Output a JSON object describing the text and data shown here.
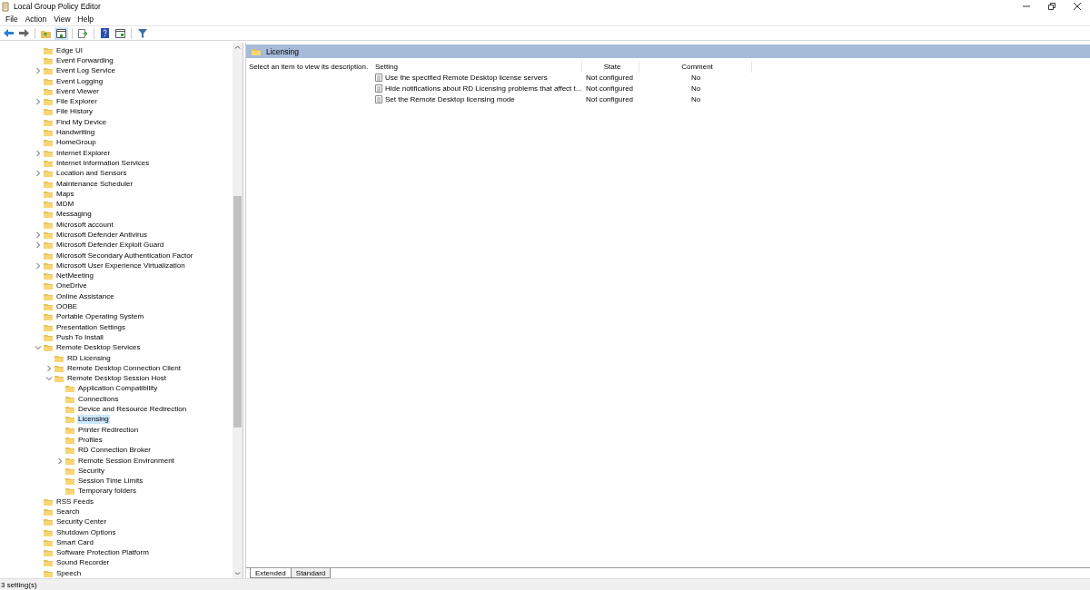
{
  "window": {
    "title": "Local Group Policy Editor"
  },
  "menu": [
    "File",
    "Action",
    "View",
    "Help"
  ],
  "tree": [
    {
      "label": "Edge UI",
      "selected": false
    },
    {
      "label": "Event Forwarding",
      "selected": false
    },
    {
      "label": "Event Log Service",
      "selected": false,
      "expanded": false
    },
    {
      "label": "Event Logging",
      "selected": false
    },
    {
      "label": "Event Viewer",
      "selected": false
    },
    {
      "label": "File Explorer",
      "selected": false,
      "expanded": false
    },
    {
      "label": "File History",
      "selected": false
    },
    {
      "label": "Find My Device",
      "selected": false
    },
    {
      "label": "Handwriting",
      "selected": false
    },
    {
      "label": "HomeGroup",
      "selected": false
    },
    {
      "label": "Internet Explorer",
      "selected": false,
      "expanded": false
    },
    {
      "label": "Internet Information Services",
      "selected": false
    },
    {
      "label": "Location and Sensors",
      "selected": false,
      "expanded": false
    },
    {
      "label": "Maintenance Scheduler",
      "selected": false
    },
    {
      "label": "Maps",
      "selected": false
    },
    {
      "label": "MDM",
      "selected": false
    },
    {
      "label": "Messaging",
      "selected": false
    },
    {
      "label": "Microsoft account",
      "selected": false
    },
    {
      "label": "Microsoft Defender Antivirus",
      "selected": false,
      "expanded": false
    },
    {
      "label": "Microsoft Defender Exploit Guard",
      "selected": false,
      "expanded": false
    },
    {
      "label": "Microsoft Secondary Authentication Factor",
      "selected": false
    },
    {
      "label": "Microsoft User Experience Virtualization",
      "selected": false,
      "expanded": false
    },
    {
      "label": "NetMeeting",
      "selected": false
    },
    {
      "label": "OneDrive",
      "selected": false
    },
    {
      "label": "Online Assistance",
      "selected": false
    },
    {
      "label": "OOBE",
      "selected": false
    },
    {
      "label": "Portable Operating System",
      "selected": false
    },
    {
      "label": "Presentation Settings",
      "selected": false
    },
    {
      "label": "Push To Install",
      "selected": false
    },
    {
      "label": "Remote Desktop Services",
      "selected": false,
      "expanded": true,
      "children": [
        {
          "label": "RD Licensing",
          "selected": false
        },
        {
          "label": "Remote Desktop Connection Client",
          "selected": false,
          "expanded": false
        },
        {
          "label": "Remote Desktop Session Host",
          "selected": false,
          "expanded": true,
          "children": [
            {
              "label": "Application Compatibility",
              "selected": false
            },
            {
              "label": "Connections",
              "selected": false
            },
            {
              "label": "Device and Resource Redirection",
              "selected": false
            },
            {
              "label": "Licensing",
              "selected": true
            },
            {
              "label": "Printer Redirection",
              "selected": false
            },
            {
              "label": "Profiles",
              "selected": false
            },
            {
              "label": "RD Connection Broker",
              "selected": false
            },
            {
              "label": "Remote Session Environment",
              "selected": false,
              "expanded": false
            },
            {
              "label": "Security",
              "selected": false
            },
            {
              "label": "Session Time Limits",
              "selected": false
            },
            {
              "label": "Temporary folders",
              "selected": false
            }
          ]
        }
      ]
    },
    {
      "label": "RSS Feeds",
      "selected": false
    },
    {
      "label": "Search",
      "selected": false
    },
    {
      "label": "Security Center",
      "selected": false
    },
    {
      "label": "Shutdown Options",
      "selected": false
    },
    {
      "label": "Smart Card",
      "selected": false
    },
    {
      "label": "Software Protection Platform",
      "selected": false
    },
    {
      "label": "Sound Recorder",
      "selected": false
    },
    {
      "label": "Speech",
      "selected": false
    }
  ],
  "panel": {
    "title": "Licensing",
    "description": "Select an item to view its description."
  },
  "table": {
    "columns": [
      "Setting",
      "State",
      "Comment"
    ],
    "rows": [
      [
        "Use the specified Remote Desktop license servers",
        "Not configured",
        "No"
      ],
      [
        "Hide notifications about RD Licensing problems that affect t...",
        "Not configured",
        "No"
      ],
      [
        "Set the Remote Desktop licensing mode",
        "Not configured",
        "No"
      ]
    ]
  },
  "tabs": [
    {
      "label": "Extended",
      "selected": true
    },
    {
      "label": "Standard",
      "selected": false
    }
  ],
  "status_bar": "3 setting(s)"
}
